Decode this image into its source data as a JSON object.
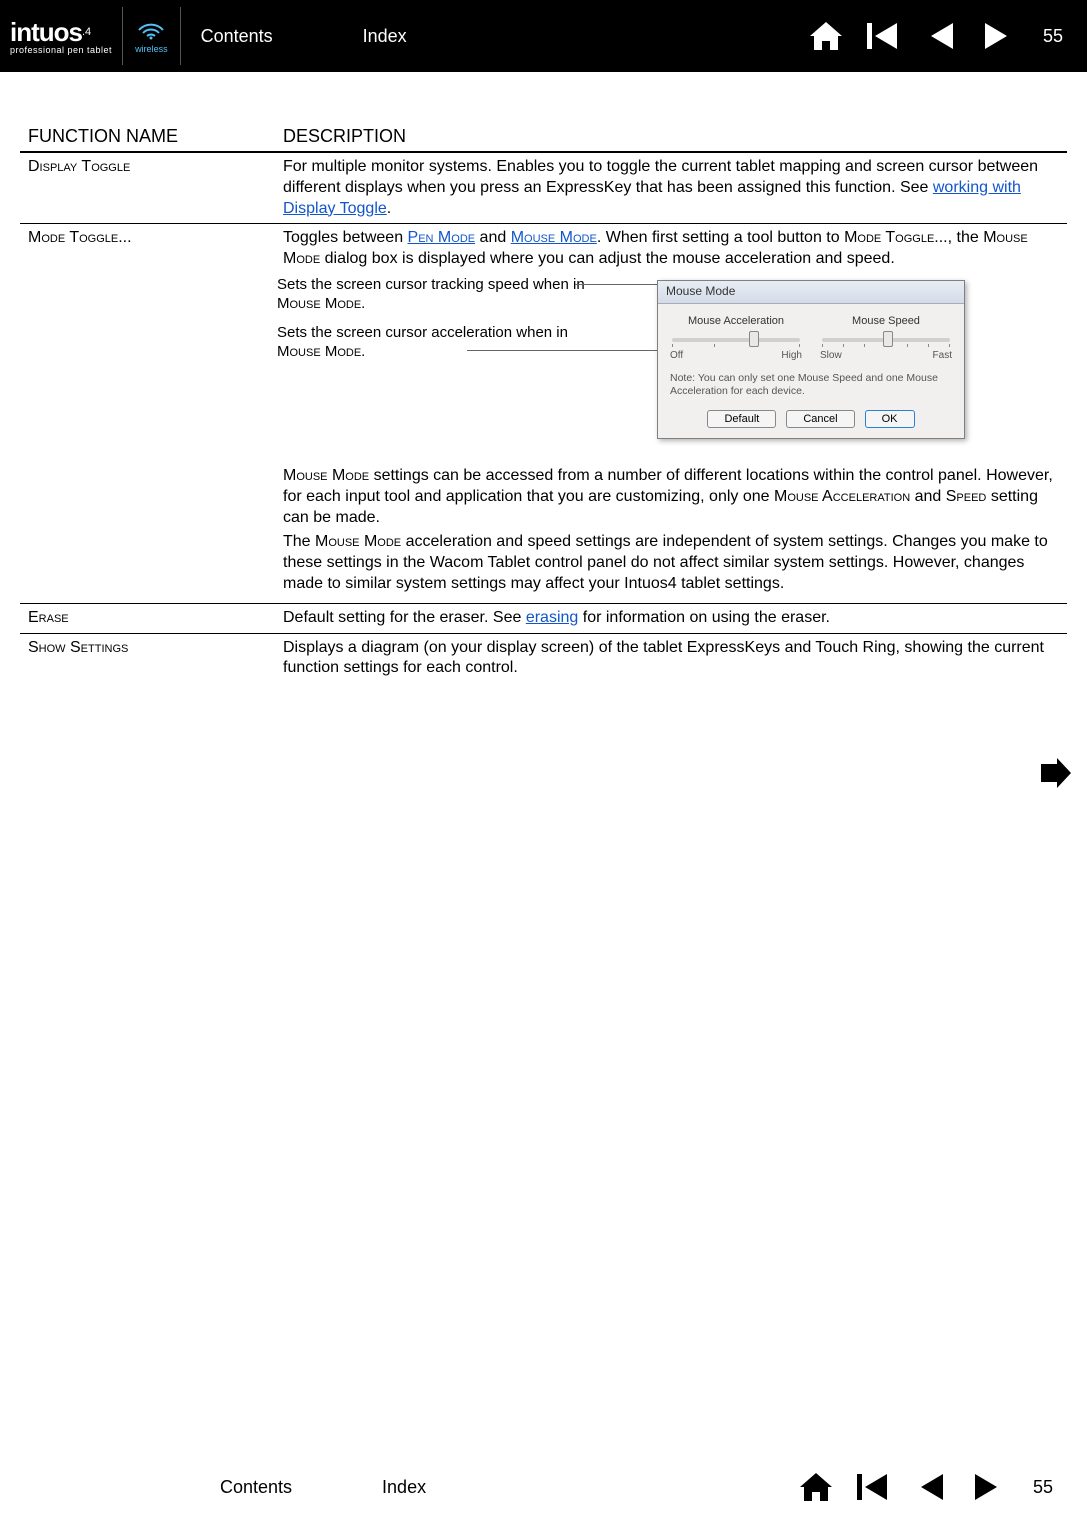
{
  "header": {
    "logo_main": "intuos",
    "logo_suffix": ".4",
    "logo_sub": "professional pen tablet",
    "wireless_label": "wireless",
    "contents": "Contents",
    "index": "Index",
    "page": "55"
  },
  "table": {
    "col_name": "FUNCTION NAME",
    "col_desc": "DESCRIPTION",
    "rows": {
      "display_toggle": {
        "name": "Display Toggle",
        "desc_pre": "For multiple monitor systems.  Enables you to toggle the current tablet mapping and screen cursor between different displays when you press an ExpressKey that has been assigned this function.  See ",
        "desc_link": "working with Display Toggle",
        "desc_post": "."
      },
      "mode_toggle": {
        "name": "Mode Toggle...",
        "desc_p1_a": "Toggles between ",
        "desc_p1_link1": "Pen Mode",
        "desc_p1_b": " and ",
        "desc_p1_link2": "Mouse Mode",
        "desc_p1_c": ".  When first setting a tool button to ",
        "desc_p1_d": "Mode Toggle...",
        "desc_p1_e": ", the ",
        "desc_p1_f": "Mouse Mode",
        "desc_p1_g": " dialog box is displayed where you can adjust the mouse acceleration and speed.",
        "annot1_a": "Sets the screen cursor tracking speed when in ",
        "annot1_b": "Mouse Mode",
        "annot1_c": ".",
        "annot2_a": "Sets the screen cursor acceleration when in ",
        "annot2_b": "Mouse Mode",
        "annot2_c": ".",
        "desc_p2_a": "Mouse Mode",
        "desc_p2_b": " settings can be accessed from a number of different locations within the control panel.  However, for each input tool and application that you are customizing, only one ",
        "desc_p2_c": "Mouse Acceleration",
        "desc_p2_d": " and ",
        "desc_p2_e": "Speed",
        "desc_p2_f": " setting can be made.",
        "desc_p3_a": "The ",
        "desc_p3_b": "Mouse Mode",
        "desc_p3_c": " acceleration and speed settings are independent of system settings.  Changes you make to these settings in the Wacom Tablet control panel do not affect similar system settings.  However, changes made to similar system settings may affect your Intuos4 tablet settings."
      },
      "erase": {
        "name": "Erase",
        "desc_pre": "Default setting for the eraser.  See ",
        "desc_link": "erasing",
        "desc_post": " for information on using the eraser."
      },
      "show_settings": {
        "name": "Show Settings",
        "desc": "Displays a diagram (on your display screen) of the tablet ExpressKeys and Touch Ring, showing the current function settings for each control."
      }
    }
  },
  "dialog": {
    "title": "Mouse Mode",
    "accel_label": "Mouse Acceleration",
    "accel_off": "Off",
    "accel_high": "High",
    "speed_label": "Mouse Speed",
    "speed_slow": "Slow",
    "speed_fast": "Fast",
    "note": "Note: You can only set one Mouse Speed and one Mouse Acceleration for each device.",
    "default": "Default",
    "cancel": "Cancel",
    "ok": "OK"
  },
  "footer": {
    "contents": "Contents",
    "index": "Index",
    "page": "55"
  }
}
